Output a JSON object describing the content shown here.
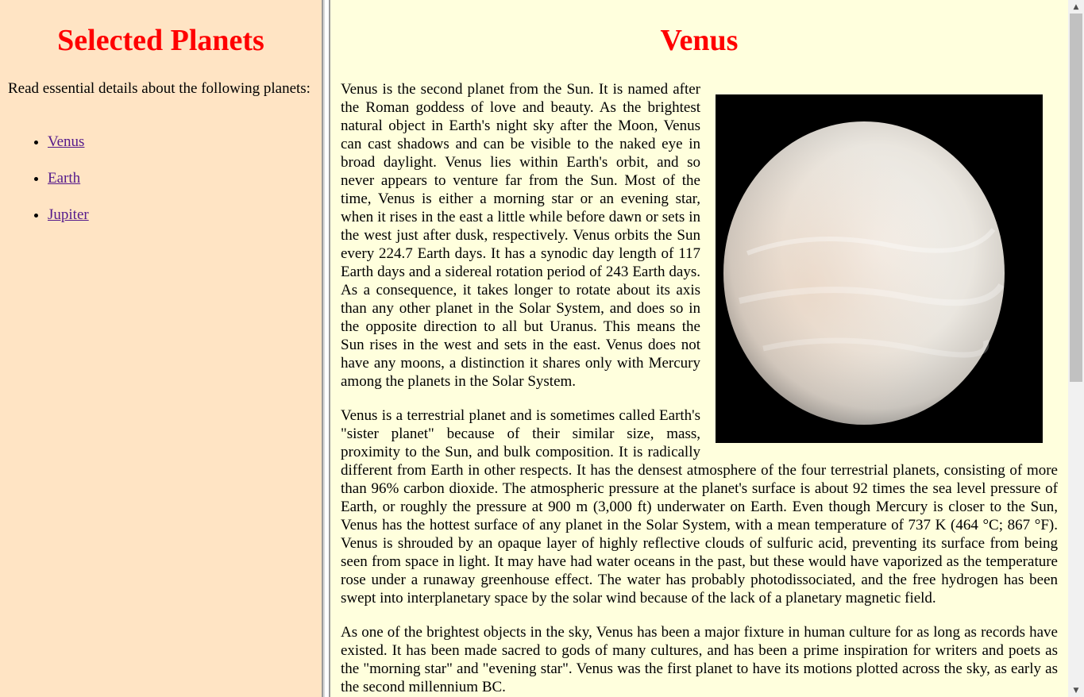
{
  "sidebar": {
    "title": "Selected Planets",
    "intro": "Read essential details about the following planets:",
    "links": [
      {
        "label": "Venus"
      },
      {
        "label": "Earth"
      },
      {
        "label": "Jupiter"
      }
    ]
  },
  "main": {
    "title": "Venus",
    "image_description": "venus-globe",
    "paragraphs": [
      "Venus is the second planet from the Sun. It is named after the Roman goddess of love and beauty. As the brightest natural object in Earth's night sky after the Moon, Venus can cast shadows and can be visible to the naked eye in broad daylight. Venus lies within Earth's orbit, and so never appears to venture far from the Sun. Most of the time, Venus is either a morning star or an evening star, when it rises in the east a little while before dawn or sets in the west just after dusk, respectively. Venus orbits the Sun every 224.7 Earth days. It has a synodic day length of 117 Earth days and a sidereal rotation period of 243 Earth days. As a consequence, it takes longer to rotate about its axis than any other planet in the Solar System, and does so in the opposite direction to all but Uranus. This means the Sun rises in the west and sets in the east. Venus does not have any moons, a distinction it shares only with Mercury among the planets in the Solar System.",
      "Venus is a terrestrial planet and is sometimes called Earth's \"sister planet\" because of their similar size, mass, proximity to the Sun, and bulk composition. It is radically different from Earth in other respects. It has the densest atmosphere of the four terrestrial planets, consisting of more than 96% carbon dioxide. The atmospheric pressure at the planet's surface is about 92 times the sea level pressure of Earth, or roughly the pressure at 900 m (3,000 ft) underwater on Earth. Even though Mercury is closer to the Sun, Venus has the hottest surface of any planet in the Solar System, with a mean temperature of 737 K (464 °C; 867 °F). Venus is shrouded by an opaque layer of highly reflective clouds of sulfuric acid, preventing its surface from being seen from space in light. It may have had water oceans in the past, but these would have vaporized as the temperature rose under a runaway greenhouse effect. The water has probably photodissociated, and the free hydrogen has been swept into interplanetary space by the solar wind because of the lack of a planetary magnetic field.",
      "As one of the brightest objects in the sky, Venus has been a major fixture in human culture for as long as records have existed. It has been made sacred to gods of many cultures, and has been a prime inspiration for writers and poets as the \"morning star\" and \"evening star\". Venus was the first planet to have its motions plotted across the sky, as early as the second millennium BC."
    ]
  },
  "scrollbar": {
    "up_icon": "triangle-up-icon",
    "down_icon": "triangle-down-icon"
  }
}
